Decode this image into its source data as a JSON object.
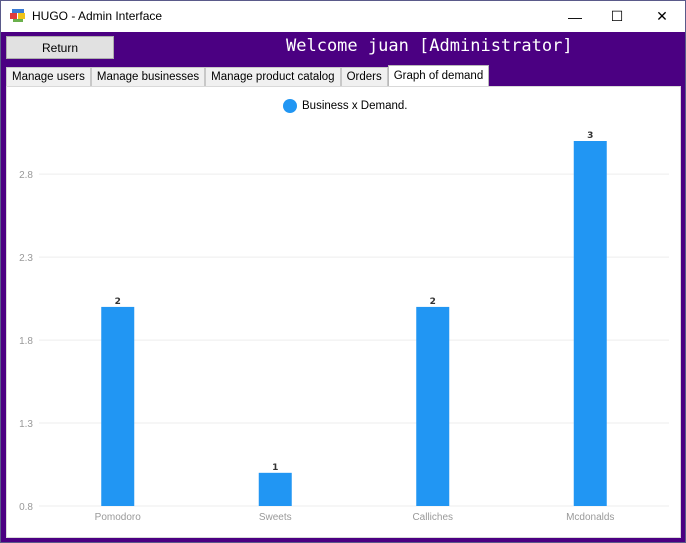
{
  "window": {
    "title": "HUGO - Admin Interface",
    "minimize_glyph": "—",
    "maximize_glyph": "☐",
    "close_glyph": "✕"
  },
  "header": {
    "return_label": "Return",
    "welcome_text": "Welcome juan [Administrator]",
    "background_color": "#4b0082"
  },
  "tabs": [
    {
      "label": "Manage users",
      "active": false
    },
    {
      "label": "Manage businesses",
      "active": false
    },
    {
      "label": "Manage product catalog",
      "active": false
    },
    {
      "label": "Orders",
      "active": false
    },
    {
      "label": "Graph of demand",
      "active": true
    }
  ],
  "chart_data": {
    "type": "bar",
    "categories": [
      "Pomodoro",
      "Sweets",
      "Calliches",
      "Mcdonalds"
    ],
    "series": [
      {
        "name": "Business x Demand.",
        "values": [
          2,
          1,
          2,
          3
        ],
        "color": "#2196f3"
      }
    ],
    "yticks": [
      "0.8",
      "1.3",
      "1.8",
      "2.3",
      "2.8"
    ],
    "ylim": [
      0.8,
      3.0
    ],
    "grid": true,
    "legend_position": "top-center"
  }
}
